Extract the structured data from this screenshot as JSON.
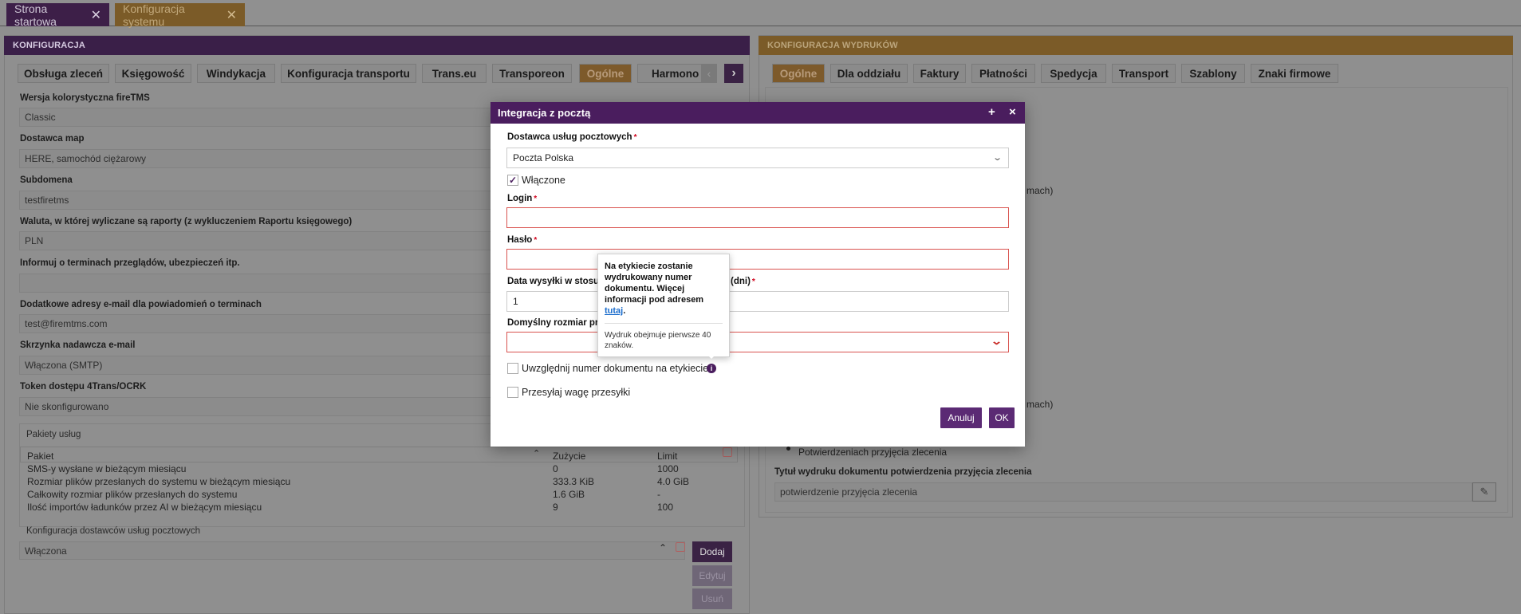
{
  "tabs": [
    {
      "label": "Strona startowa",
      "close": "✕"
    },
    {
      "label": "Konfiguracja systemu",
      "close": "✕"
    }
  ],
  "left_panel": {
    "title": "KONFIGURACJA",
    "subtabs": [
      "Obsługa zleceń",
      "Księgowość",
      "Windykacja",
      "Konfiguracja transportu",
      "Trans.eu",
      "Transporeon",
      "Ogólne",
      "Harmono"
    ],
    "fields": [
      {
        "label": "Wersja kolorystyczna fireTMS",
        "value": "Classic"
      },
      {
        "label": "Dostawca map",
        "value": "HERE, samochód ciężarowy"
      },
      {
        "label": "Subdomena",
        "value": "testfiretms"
      },
      {
        "label": "Waluta, w której wyliczane są raporty (z wykluczeniem Raportu księgowego)",
        "value": "PLN"
      },
      {
        "label": "Informuj o terminach przeglądów, ubezpieczeń itp.",
        "value": ""
      },
      {
        "label": "Dodatkowe adresy e-mail dla powiadomień o terminach",
        "value": "test@firemtms.com"
      },
      {
        "label": "Skrzynka nadawcza e-mail",
        "value": "Włączona (SMTP)"
      },
      {
        "label": "Token dostępu 4Trans/OCRK",
        "value": "Nie skonfigurowano"
      }
    ],
    "packages": {
      "title": "Pakiety usług",
      "columns": [
        "Pakiet",
        "Zużycie",
        "Limit"
      ],
      "rows": [
        [
          "SMS-y wysłane w bieżącym miesiącu",
          "0",
          "1000"
        ],
        [
          "Rozmiar plików przesłanych do systemu w bieżącym miesiącu",
          "333.3 KiB",
          "4.0 GiB"
        ],
        [
          "Całkowity rozmiar plików przesłanych do systemu",
          "1.6 GiB",
          "-"
        ],
        [
          "Ilość importów ładunków przez AI w bieżącym miesiącu",
          "9",
          "100"
        ]
      ]
    },
    "postal": {
      "title": "Konfiguracja dostawców usług pocztowych",
      "value": "Włączona",
      "buttons": {
        "add": "Dodaj",
        "edit": "Edytuj",
        "delete": "Usuń"
      }
    }
  },
  "right_panel": {
    "title": "KONFIGURACJA WYDRUKÓW",
    "subtabs": [
      "Ogólne",
      "Dla oddziału",
      "Faktury",
      "Płatności",
      "Spedycja",
      "Transport",
      "Szablony",
      "Znaki firmowe"
    ],
    "frag1": "mach)",
    "frag2": "mach)",
    "bullet": "Potwierdzeniach przyjęcia zlecenia",
    "field_label": "Tytuł wydruku dokumentu potwierdzenia przyjęcia zlecenia",
    "field_value": "potwierdzenie przyjęcia zlecenia"
  },
  "modal": {
    "title": "Integracja z pocztą",
    "provider_label": "Dostawca usług pocztowych",
    "provider_value": "Poczta Polska",
    "enabled_label": "Włączone",
    "login_label": "Login",
    "password_label": "Hasło",
    "date_label_start": "Data wysyłki w stosun",
    "date_label_end": "(dni)",
    "date_value": "1",
    "size_label": "Domyślny rozmiar prz",
    "include_number_label": "Uwzględnij numer dokumentu na etykiecie",
    "send_weight_label": "Przesyłaj wagę przesyłki",
    "cancel": "Anuluj",
    "ok": "OK",
    "required_mark": "*"
  },
  "tooltip": {
    "text": "Na etykiecie zostanie wydrukowany numer dokumentu. Więcej informacji pod adresem",
    "link": "tutaj",
    "period": ".",
    "note": "Wydruk obejmuje pierwsze 40 znaków."
  },
  "colors": {
    "accent": "#4a1d5e",
    "error": "#d9534f",
    "link": "#1a6ccc"
  }
}
